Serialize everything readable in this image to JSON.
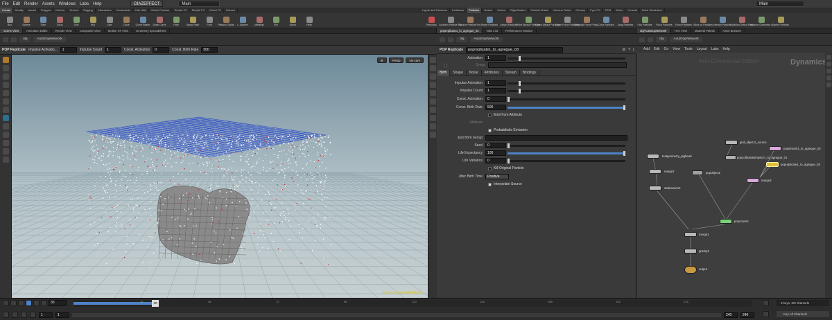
{
  "menubar": {
    "items": [
      "File",
      "Edit",
      "Render",
      "Assets",
      "Windows",
      "Labs",
      "Help"
    ],
    "desktop": "DIAZEFFECT",
    "context_main": "Main",
    "right_main": "Main"
  },
  "shelf_left": {
    "tabs": [
      "Create",
      "Modify",
      "Model",
      "Polygon",
      "Deform",
      "Texture",
      "Rigging",
      "Characters",
      "Constraints",
      "Hair Utils",
      "Guide Process",
      "Terrain FX",
      "Simple FX",
      "Cloud FX",
      "Volume"
    ],
    "tools": [
      "Box",
      "Sphere",
      "Tube",
      "Torus",
      "Grid",
      "Null",
      "Line",
      "Circle",
      "Curve Bezier",
      "Draw Curve",
      "Path",
      "Spray Paint",
      "Font",
      "Platonic Solids",
      "L-System",
      "Metaball",
      "File",
      "Spiral",
      "Helix"
    ]
  },
  "shelf_right": {
    "tabs": [
      "Lights and Cameras",
      "Collisions",
      "Particles",
      "Grains",
      "Vellum",
      "Rigid Bodies",
      "Particle Fluids",
      "Viscous Fluids",
      "Oceans",
      "Pyro FX",
      "FEM",
      "Wires",
      "Crowds",
      "Drive Simulation"
    ],
    "tools": [
      "Location Particle Em.",
      "Source Particle Em.",
      "Repel Particles",
      "Attract Particles",
      "Point Attract Particles",
      "Curve Attract Particles",
      "Curve Force Particles",
      "Metaball Force Partic.",
      "Color Particles",
      "Drag Particles",
      "Fan Particles",
      "Flock Particles",
      "Force Particles",
      "Wind on Particles",
      "Interact Particles",
      "Collision Detect Part.",
      "Instance Geometry o.",
      "Sprite Particles"
    ],
    "fireworks": "Fireworks"
  },
  "viewer": {
    "tabs": [
      "Scene View",
      "Animation Editor",
      "Render View",
      "Composite View",
      "Motion FX View",
      "Geometry Spreadsheet"
    ],
    "path": [
      "obj",
      "AutoDopNetwork"
    ],
    "node_type": "POP Replicate",
    "impulse_activation_label": "Impulse Activatio...",
    "impulse_activation": "1",
    "impulse_count_label": "Impulse Count",
    "impulse_count": "1",
    "const_activation_label": "Const. Activation",
    "const_activation": "0",
    "const_birth_rate_label": "Const. Birth Rate",
    "const_birth_rate": "500",
    "persp": "Persp",
    "cam": "No cam",
    "watermark": "Non-Commercial Edition"
  },
  "parms": {
    "tabs_top": [
      "popreplicate1_lo_agregue_03",
      "Take List",
      "Performance Monitor"
    ],
    "path": [
      "obj",
      "AutoDopNetwork"
    ],
    "node_type": "POP Replicate",
    "node_name": "popreplicate1_lo_agregue_03",
    "activation_label": "Activation",
    "activation": "1",
    "group_label": "Group",
    "subtabs": [
      "Birth",
      "Shape",
      "Noise",
      "Attributes",
      "Stream",
      "Bindings"
    ],
    "impulse_activation_label": "Impulse Activation",
    "impulse_activation": "1",
    "impulse_count_label": "Impulse Count",
    "impulse_count": "1",
    "const_activation_label": "Const. Activation",
    "const_activation": "0",
    "const_birth_rate_label": "Const. Birth Rate",
    "const_birth_rate": "500",
    "emit_from_attribute": "Emit from Attribute",
    "attribute_label": "Attribute",
    "probabilistic_emission": "Probabilistic Emission",
    "just_born_group_label": "Just Born Group",
    "seed_label": "Seed",
    "seed": "0",
    "life_expectancy_label": "Life Expectancy",
    "life_expectancy": "100",
    "life_variance_label": "Life Variance",
    "life_variance": "0",
    "kill_original_particle": "Kill Original Particle",
    "jitter_birth_time_label": "Jitter Birth Time",
    "jitter_birth_time": "Positive",
    "interpolate_source": "Interpolate Source"
  },
  "network": {
    "tabs_top": [
      "obj/AutoDopNetwork",
      "Tree View",
      "Material Palette",
      "Asset Browser"
    ],
    "path": [
      "obj",
      "AutoDopNetwork"
    ],
    "menu": [
      "Add",
      "Edit",
      "Go",
      "View",
      "Tools",
      "Layout",
      "Labs",
      "Help"
    ],
    "watermark": "Non-Commercial Edition",
    "context": "Dynamics",
    "nodes": {
      "testgeometry": "testgeometry_pighead",
      "merge2": "merge2",
      "staticsolver1": "staticsolver1",
      "popobject1": "popobject1",
      "grid_source": "grid_object1_source",
      "popstream": "popstream1_lo_agregue_02",
      "popcollision": "popcollisionbehavior1_lo_agregue_01",
      "popreplicate": "popreplicate1_lo_agregue_03",
      "merge3": "merge3",
      "popsolver1": "popsolver1",
      "merge1": "merge1",
      "gravity1": "gravity1",
      "output": "output"
    }
  },
  "timeline": {
    "current_frame": "30",
    "marker": "30",
    "ticks": [
      "24",
      "48",
      "72",
      "96",
      "120",
      "144",
      "168",
      "192",
      "216"
    ],
    "start": "1",
    "start2": "1",
    "end": "240",
    "end2": "240",
    "keys_info": "0 keys, 0/0 channels",
    "key_all": "Key All Channels"
  },
  "colors": {
    "accent": "#4d84c8",
    "selected_node": "#e0c040",
    "pop_node": "#c060c0",
    "dop_node": "#60c060"
  }
}
